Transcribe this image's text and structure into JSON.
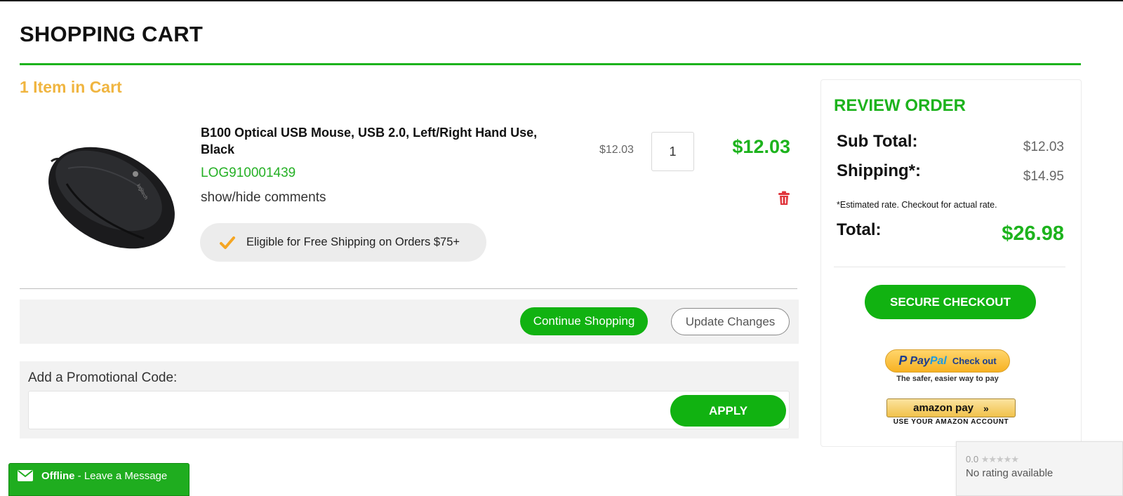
{
  "page": {
    "title": "SHOPPING CART",
    "items_count": "1 Item in Cart"
  },
  "cart_item": {
    "image_icon": "computer-mouse-image",
    "name": "B100 Optical USB Mouse, USB 2.0, Left/Right Hand Use, Black",
    "sku": "LOG910001439",
    "comments_toggle": "show/hide comments",
    "shipping_note": "Eligible for Free Shipping on Orders $75+",
    "unit_price": "$12.03",
    "quantity": "1",
    "line_total": "$12.03",
    "remove_icon": "trash-icon"
  },
  "actions": {
    "continue_label": "Continue Shopping",
    "update_label": "Update Changes"
  },
  "promo": {
    "label": "Add a Promotional Code:",
    "input_value": "",
    "apply_label": "APPLY"
  },
  "review": {
    "title": "REVIEW ORDER",
    "subtotal_label": "Sub Total:",
    "subtotal_value": "$12.03",
    "shipping_label": "Shipping*:",
    "shipping_value": "$14.95",
    "estimate_note": "*Estimated rate. Checkout for actual rate.",
    "total_label": "Total:",
    "total_value": "$26.98",
    "checkout_label": "SECURE CHECKOUT",
    "paypal_label_pay": "Pay",
    "paypal_label_pal": "Pal",
    "paypal_checkout": "Check out",
    "paypal_tagline": "The safer, easier way to pay",
    "amazon_label": "amazon pay",
    "amazon_arrows": "»",
    "amazon_tagline": "USE YOUR AMAZON ACCOUNT"
  },
  "chat": {
    "status": "Offline",
    "message": " - Leave a Message"
  },
  "rating": {
    "score": "0.0",
    "stars": "★★★★★",
    "caption": "No rating available"
  },
  "colors": {
    "accent_green": "#1db31d",
    "items_count_yellow": "#f0b540",
    "check_orange": "#f5a623",
    "trash_red": "#e0353c"
  }
}
